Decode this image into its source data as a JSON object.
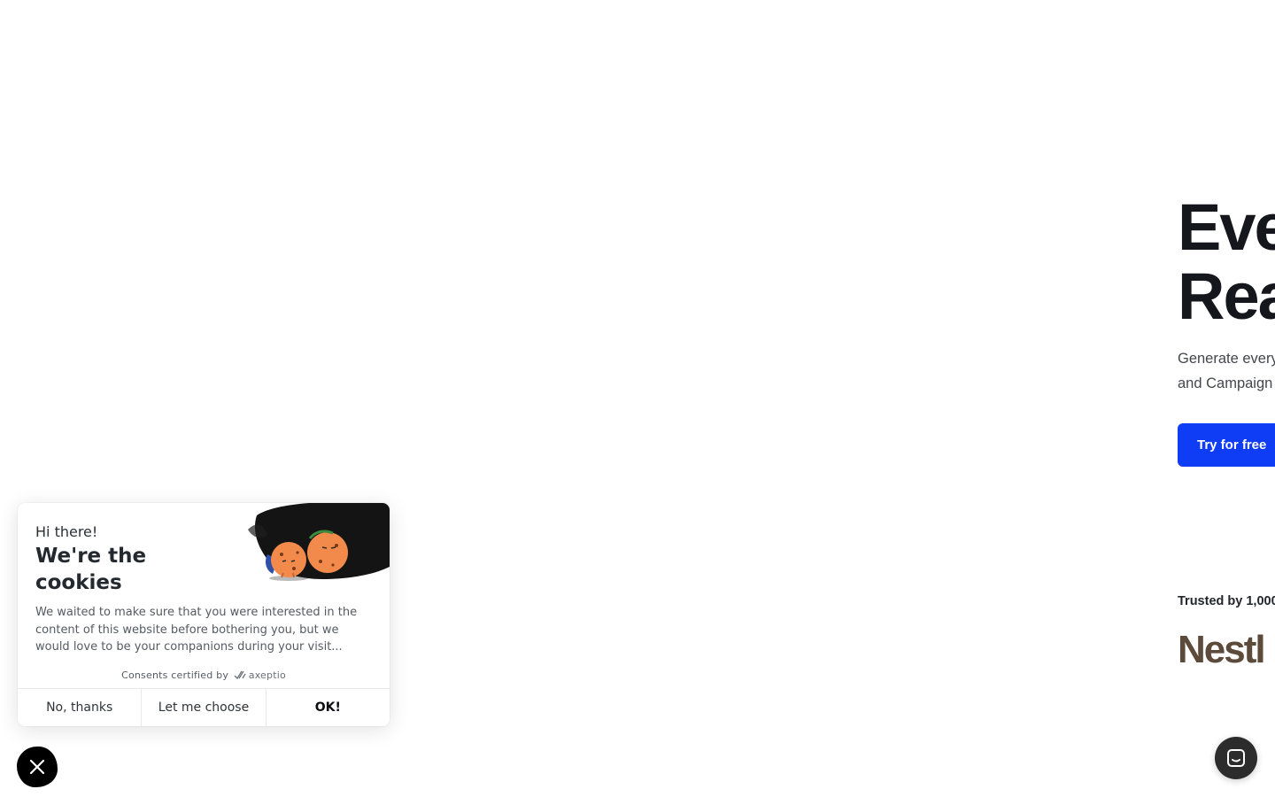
{
  "hero": {
    "title_line1": "Eve",
    "title_line2": "Rea",
    "subtitle_line1": "Generate every",
    "subtitle_line2": "and Campaign",
    "cta_label": "Try for free",
    "trusted_text": "Trusted by 1,000",
    "logo_text": "Nestl"
  },
  "cookie_banner": {
    "greeting": "Hi there!",
    "title": "We're the cookies",
    "body": "We waited to make sure that you were interested in the content of this website before bothering you, but we would love to be your companions during your visit...",
    "certified_prefix": "Consents certified by",
    "certified_brand": "axeptio",
    "buttons": {
      "decline": "No, thanks",
      "choose": "Let me choose",
      "accept": "OK!"
    },
    "illustration_icon": "cookies-illustration"
  },
  "floating": {
    "consent_close_icon": "close-icon",
    "chat_icon": "chat-icon"
  },
  "colors": {
    "cta_blue": "#0f3cf5",
    "brand_brown": "#5c4a3a",
    "close_button": "#000000",
    "chat_button": "#2c2c2c"
  }
}
